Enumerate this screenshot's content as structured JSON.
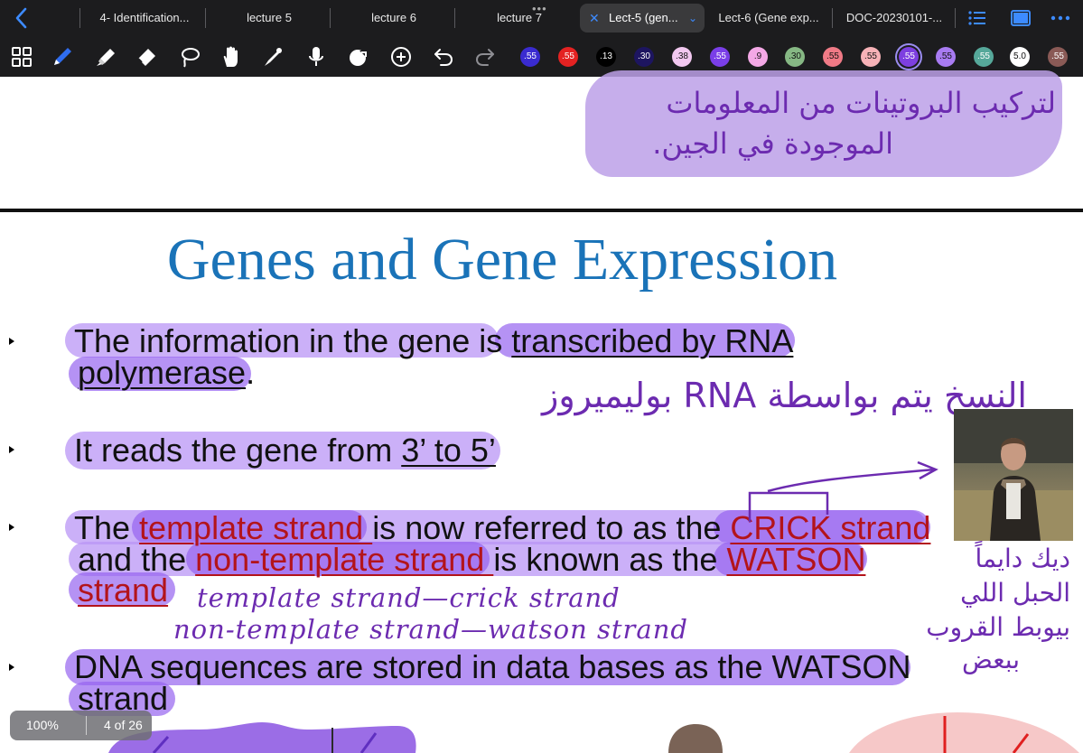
{
  "tabs": {
    "back_icon": "chevron-left-icon",
    "items": [
      {
        "label": "4- Identification..."
      },
      {
        "label": "lecture 5"
      },
      {
        "label": "lecture 6"
      },
      {
        "label": "lecture 7"
      },
      {
        "label": "Lect-5 (gen...",
        "active": true
      },
      {
        "label": "Lect-6 (Gene exp..."
      },
      {
        "label": "DOC-20230101-..."
      }
    ],
    "right_icons": [
      "list-icon",
      "sidebar-icon",
      "more-icon"
    ]
  },
  "toolbar": {
    "tools": [
      "grid-icon",
      "pen-icon",
      "highlighter-icon",
      "eraser-icon",
      "lasso-icon",
      "hand-icon",
      "pointer-icon",
      "microphone-icon",
      "shapes-icon",
      "add-icon",
      "undo-icon",
      "redo-icon"
    ],
    "swatches": [
      {
        "label": ".55",
        "color": "#3a2bd0"
      },
      {
        "label": ".55",
        "color": "#e42222"
      },
      {
        "label": ".13",
        "color": "#000000"
      },
      {
        "label": ".30",
        "color": "#1d1560"
      },
      {
        "label": ".38",
        "color": "#f2c8f0"
      },
      {
        "label": ".55",
        "color": "#7a3ee8"
      },
      {
        "label": ".9",
        "color": "#f4a8e6"
      },
      {
        "label": ".30",
        "color": "#86b884"
      },
      {
        "label": ".55",
        "color": "#f07a86"
      },
      {
        "label": ".55",
        "color": "#f7b2b7"
      },
      {
        "label": ".55",
        "color": "#7d3fe0",
        "selected": true
      },
      {
        "label": ".55",
        "color": "#a87bf2"
      },
      {
        "label": ".55",
        "color": "#56a89a"
      },
      {
        "label": "5.0",
        "color": "#ffffff"
      },
      {
        "label": ".55",
        "color": "#8a5a56"
      }
    ]
  },
  "notes": {
    "top_arabic_line1": "لتركيب البروتينات من المعلومات",
    "top_arabic_line2": "الموجودة في الجين.",
    "rna_note": "النسخ يتم بواسطة RNA بوليميروز",
    "side_note_l1": "ديك دايماً",
    "side_note_l2": "الحبل اللي",
    "side_note_l3": "بيوبط القروب",
    "side_note_l4": "ببعض",
    "handwritten_1": "template strand—crick strand",
    "handwritten_2": "non-template strand—watson strand"
  },
  "slide": {
    "title": "Genes and Gene Expression",
    "b1": {
      "t1": "The information in the gene is ",
      "t2": "transcribed by RNA",
      "t3": "polymerase",
      "t4": "."
    },
    "b2": {
      "t1": "It reads the gene from ",
      "t2": "3’ to 5’"
    },
    "b3": {
      "t1": "The ",
      "t2": "template strand ",
      "t3": "is now referred to as the ",
      "t4": "CRICK strand",
      "t5": "and the ",
      "t6": "non-template strand ",
      "t7": "is known as the ",
      "t8": "WATSON",
      "t9": "strand"
    },
    "b4": {
      "t1": "DNA sequences are stored in data bases as the WATSON",
      "t2": "strand"
    }
  },
  "footer": {
    "zoom": "100%",
    "page": "4 of 26"
  }
}
